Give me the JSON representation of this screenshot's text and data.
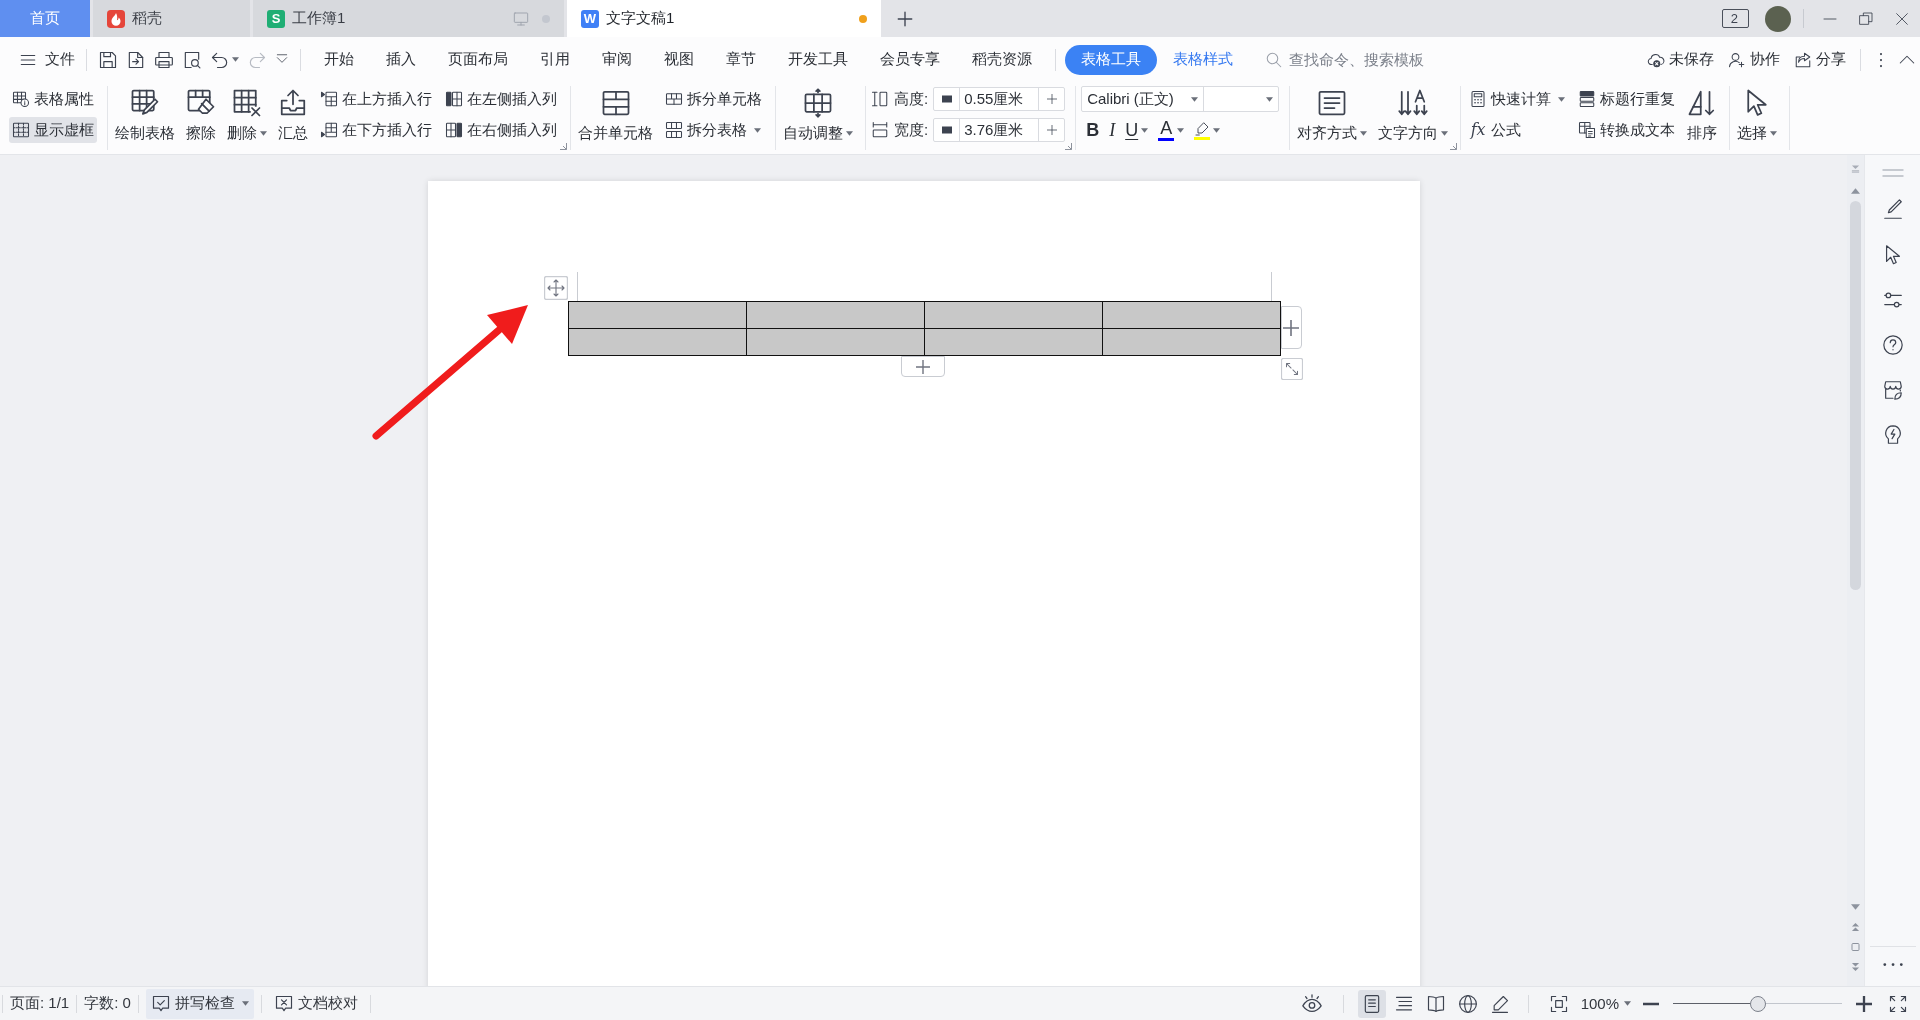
{
  "tabs": [
    {
      "label": "首页",
      "kind": "home",
      "selected": false,
      "unsaved": false
    },
    {
      "label": "稻壳",
      "kind": "docer",
      "selected": false,
      "unsaved": false
    },
    {
      "label": "工作簿1",
      "kind": "sheet",
      "glyph": "S",
      "selected": false,
      "unsaved": true
    },
    {
      "label": "文字文稿1",
      "kind": "writer",
      "glyph": "W",
      "selected": true,
      "unsaved": true
    }
  ],
  "window_switch": "2",
  "menu": {
    "file": "文件",
    "quick_access": [
      {
        "disabled": false,
        "dropdown": false
      },
      {
        "disabled": false,
        "dropdown": false
      },
      {
        "disabled": false,
        "dropdown": false
      },
      {
        "disabled": false,
        "dropdown": false
      },
      {
        "disabled": false,
        "dropdown": true
      },
      {
        "disabled": true,
        "dropdown": false
      }
    ],
    "tabs": [
      {
        "label": "开始",
        "contextual": false,
        "selected": false
      },
      {
        "label": "插入",
        "contextual": false,
        "selected": false
      },
      {
        "label": "页面布局",
        "contextual": false,
        "selected": false
      },
      {
        "label": "引用",
        "contextual": false,
        "selected": false
      },
      {
        "label": "审阅",
        "contextual": false,
        "selected": false
      },
      {
        "label": "视图",
        "contextual": false,
        "selected": false
      },
      {
        "label": "章节",
        "contextual": false,
        "selected": false
      },
      {
        "label": "开发工具",
        "contextual": false,
        "selected": false
      },
      {
        "label": "会员专享",
        "contextual": false,
        "selected": false
      },
      {
        "label": "稻壳资源",
        "contextual": false,
        "selected": false
      },
      {
        "label": "表格工具",
        "contextual": true,
        "selected": true
      },
      {
        "label": "表格样式",
        "contextual": true,
        "selected": false
      }
    ],
    "search": {
      "placeholder": "查找命令、搜索模板"
    },
    "actions": [
      {
        "label": "未保存"
      },
      {
        "label": "协作"
      },
      {
        "label": "分享"
      }
    ]
  },
  "ribbon": [
    {
      "launcher": false,
      "columns": [
        {
          "kind": "stack",
          "items": [
            {
              "label": "表格属性",
              "on": false,
              "dropdown": false
            },
            {
              "label": "显示虚框",
              "on": true,
              "dropdown": false
            }
          ]
        }
      ]
    },
    {
      "launcher": true,
      "columns": [
        {
          "kind": "large",
          "label": "绘制表格",
          "dropdown": false
        },
        {
          "kind": "large",
          "label": "擦除",
          "dropdown": false
        },
        {
          "kind": "large",
          "label": "删除",
          "dropdown": true
        },
        {
          "kind": "large",
          "label": "汇总",
          "dropdown": false
        },
        {
          "kind": "stack",
          "items": [
            {
              "label": "在上方插入行",
              "dropdown": false
            },
            {
              "label": "在下方插入行",
              "dropdown": false
            }
          ]
        },
        {
          "kind": "stack",
          "items": [
            {
              "label": "在左侧插入列",
              "dropdown": false
            },
            {
              "label": "在右侧插入列",
              "dropdown": false
            }
          ]
        }
      ]
    },
    {
      "launcher": false,
      "columns": [
        {
          "kind": "large",
          "label": "合并单元格",
          "dropdown": false
        },
        {
          "kind": "stack",
          "items": [
            {
              "label": "拆分单元格",
              "dropdown": false
            },
            {
              "label": "拆分表格",
              "dropdown": true
            }
          ]
        }
      ]
    },
    {
      "launcher": false,
      "columns": [
        {
          "kind": "large",
          "label": "自动调整",
          "dropdown": true
        }
      ]
    },
    {
      "launcher": true,
      "columns": [
        {
          "kind": "spin",
          "items": [
            {
              "label": "高度:",
              "value": "0.55厘米"
            },
            {
              "label": "宽度:",
              "value": "3.76厘米"
            }
          ]
        }
      ]
    },
    {
      "launcher": false,
      "columns": [
        {
          "kind": "font",
          "font": "Calibri (正文)",
          "buttons": [
            {
              "kind": "bold",
              "label": "B",
              "dropdown": false
            },
            {
              "kind": "italic",
              "label": "I",
              "dropdown": false
            },
            {
              "kind": "underline",
              "label": "U",
              "dropdown": true
            },
            {
              "kind": "font_color",
              "label": "A",
              "dropdown": true,
              "color": "#0000ff"
            },
            {
              "kind": "highlight",
              "dropdown": true,
              "color": "#ffff00"
            }
          ]
        }
      ]
    },
    {
      "launcher": true,
      "columns": [
        {
          "kind": "large",
          "label": "对齐方式",
          "dropdown": true
        },
        {
          "kind": "large",
          "label": "文字方向",
          "dropdown": true
        }
      ]
    },
    {
      "launcher": false,
      "columns": [
        {
          "kind": "stack",
          "items": [
            {
              "label": "快速计算",
              "dropdown": true
            },
            {
              "label": "公式",
              "glyph": "fx",
              "dropdown": false
            }
          ]
        },
        {
          "kind": "stack",
          "items": [
            {
              "label": "标题行重复",
              "dropdown": false
            },
            {
              "label": "转换成文本",
              "dropdown": false
            }
          ]
        },
        {
          "kind": "large",
          "label": "排序",
          "dropdown": false
        }
      ]
    },
    {
      "launcher": false,
      "columns": [
        {
          "kind": "large",
          "label": "选择",
          "dropdown": true
        }
      ]
    }
  ],
  "document": {
    "table": {
      "rows": [
        {
          "cells": [
            {
              "shaded": true
            },
            {
              "shaded": true
            },
            {
              "shaded": true
            },
            {
              "shaded": true
            }
          ]
        },
        {
          "cells": [
            {
              "shaded": true
            },
            {
              "shaded": true
            },
            {
              "shaded": true
            },
            {
              "shaded": true
            }
          ]
        }
      ]
    },
    "annotations": [
      {
        "kind": "arrow"
      }
    ]
  },
  "status_bar": {
    "items": [
      {
        "label": "页面: 1/1",
        "kind": "info"
      },
      {
        "label": "字数: 0",
        "kind": "info"
      },
      {
        "label": "拼写检查",
        "kind": "button",
        "on": true,
        "dropdown": true
      },
      {
        "label": "文档校对",
        "kind": "button",
        "on": false,
        "dropdown": false
      }
    ],
    "views": [
      {
        "selected": true
      },
      {
        "selected": false
      },
      {
        "selected": false
      },
      {
        "selected": false
      },
      {
        "selected": false
      }
    ],
    "zoom": {
      "label": "100%",
      "level": 0.5
    }
  }
}
